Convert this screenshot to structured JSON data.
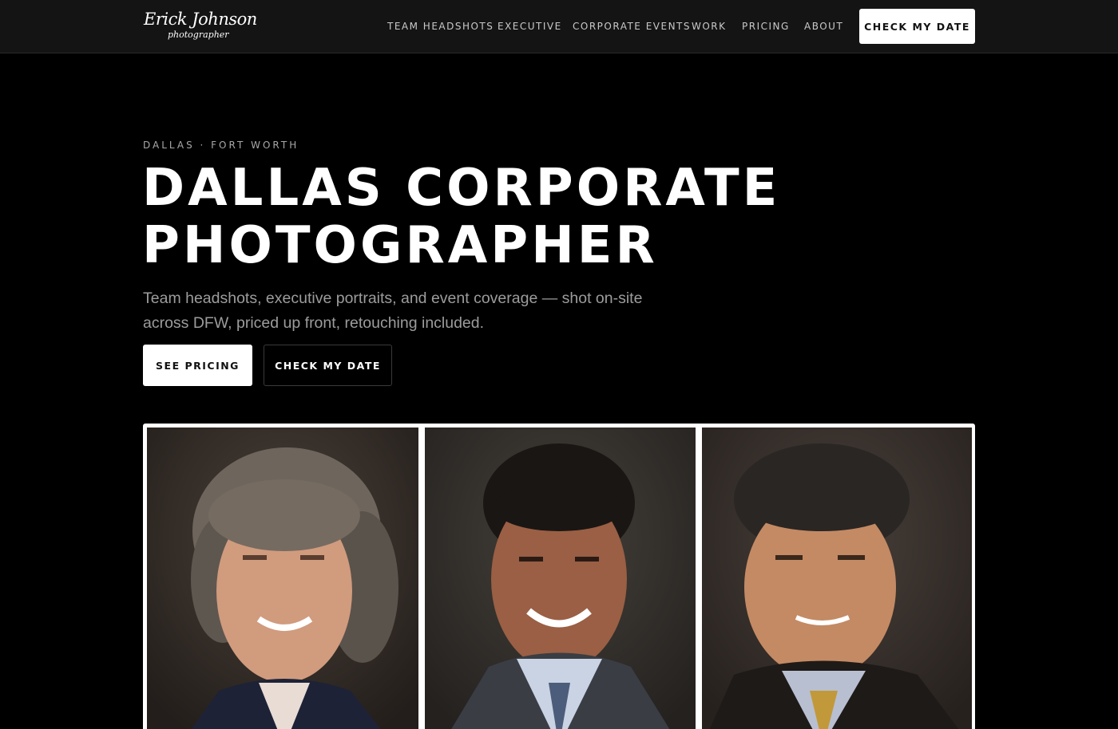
{
  "header": {
    "logo_main": "Erick Johnson",
    "logo_sub": "photographer",
    "nav": [
      "TEAM HEADSHOTS",
      "EXECUTIVE",
      "CORPORATE EVENTS",
      "WORK",
      "PRICING",
      "ABOUT"
    ],
    "cta_label": "CHECK MY DATE"
  },
  "hero": {
    "eyebrow": "DALLAS · FORT WORTH",
    "headline_line1": "DALLAS CORPORATE",
    "headline_line2": "PHOTOGRAPHER",
    "subhead": "Team headshots, executive portraits, and event coverage — shot on-site across DFW, priced up front, retouching included.",
    "primary_button": "SEE PRICING",
    "secondary_button": "CHECK MY DATE"
  },
  "colors": {
    "background": "#000000",
    "header_bg": "#141414",
    "button_light": "#ffffff",
    "muted_text": "#9c9c9c"
  }
}
